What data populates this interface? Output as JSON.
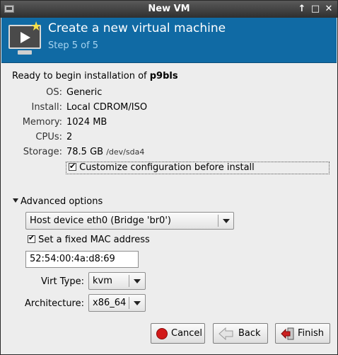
{
  "window": {
    "title": "New VM",
    "controls": [
      "↑",
      "□",
      "✕"
    ]
  },
  "banner": {
    "headline": "Create a new virtual machine",
    "step": "Step 5 of 5"
  },
  "summary": {
    "ready_prefix": "Ready to begin installation of ",
    "vm_name": "p9bls",
    "rows": [
      {
        "label": "OS:",
        "value": "Generic",
        "extra": ""
      },
      {
        "label": "Install:",
        "value": "Local CDROM/ISO",
        "extra": ""
      },
      {
        "label": "Memory:",
        "value": "1024 MB",
        "extra": ""
      },
      {
        "label": "CPUs:",
        "value": "2",
        "extra": ""
      },
      {
        "label": "Storage:",
        "value": "78.5 GB",
        "extra": "/dev/sda4"
      }
    ],
    "customize_label": "Customize configuration before install",
    "customize_checked": true
  },
  "advanced": {
    "toggle_label": "Advanced options",
    "network_selected": "Host device eth0 (Bridge 'br0')",
    "mac_label": "Set a fixed MAC address",
    "mac_checked": true,
    "mac_value": "52:54:00:4a:d8:69",
    "virt_type_label": "Virt Type:",
    "virt_type_value": "kvm",
    "arch_label": "Architecture:",
    "arch_value": "x86_64"
  },
  "buttons": {
    "cancel": "Cancel",
    "back": "Back",
    "finish": "Finish"
  },
  "icons": {
    "app": "vm-manager-icon",
    "banner": "new-vm-monitor-icon",
    "cancel": "stop-icon",
    "back": "back-arrow-icon",
    "finish": "finish-door-icon"
  },
  "colors": {
    "banner": "#106aa4",
    "banner_step": "#a7d4f0",
    "titlebar": "#3c3c3c",
    "cancel_icon": "#d21a1a"
  }
}
